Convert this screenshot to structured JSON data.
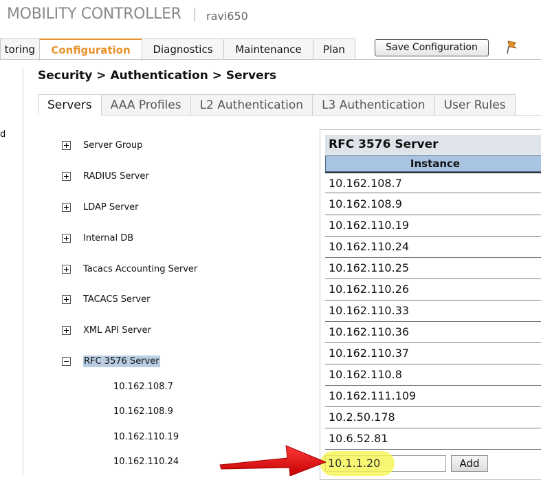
{
  "header": {
    "brand": "MOBILITY CONTROLLER",
    "user": "ravi650"
  },
  "topnav": {
    "tabs": [
      {
        "label": "toring"
      },
      {
        "label": "Configuration"
      },
      {
        "label": "Diagnostics"
      },
      {
        "label": "Maintenance"
      },
      {
        "label": "Plan"
      }
    ],
    "save_label": "Save Configuration"
  },
  "left_gutter_text": "d",
  "breadcrumb": "Security > Authentication > Servers",
  "subtabs": [
    "Servers",
    "AAA Profiles",
    "L2 Authentication",
    "L3 Authentication",
    "User Rules"
  ],
  "tree": {
    "items": [
      {
        "label": "Server Group"
      },
      {
        "label": "RADIUS Server"
      },
      {
        "label": "LDAP Server"
      },
      {
        "label": "Internal DB"
      },
      {
        "label": "Tacacs Accounting Server"
      },
      {
        "label": "TACACS Server"
      },
      {
        "label": "XML API Server"
      },
      {
        "label": "RFC 3576 Server"
      }
    ],
    "children": [
      "10.162.108.7",
      "10.162.108.9",
      "10.162.110.19",
      "10.162.110.24"
    ]
  },
  "panel": {
    "title": "RFC 3576 Server",
    "column": "Instance",
    "rows": [
      "10.162.108.7",
      "10.162.108.9",
      "10.162.110.19",
      "10.162.110.24",
      "10.162.110.25",
      "10.162.110.26",
      "10.162.110.33",
      "10.162.110.36",
      "10.162.110.37",
      "10.162.110.8",
      "10.162.111.109",
      "10.2.50.178",
      "10.6.52.81"
    ],
    "input_value": "10.1.1.20",
    "add_label": "Add"
  },
  "colors": {
    "accent": "#e8922c",
    "header_blue": "#a8c4e0",
    "highlight": "#f5f550",
    "arrow": "#e81a1a"
  }
}
